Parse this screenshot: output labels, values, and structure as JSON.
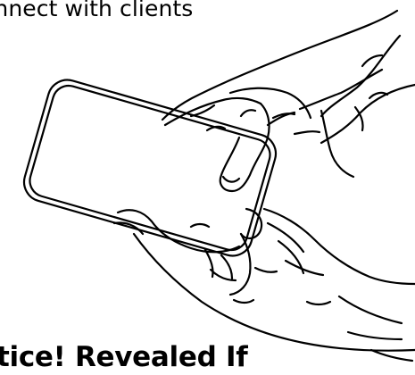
{
  "header": {
    "caption": "onnect with clients"
  },
  "footer": {
    "heading": "tice! Revealed If"
  },
  "illustration": {
    "subject": "hands-holding-phone-line-art",
    "stroke_color": "#000000",
    "background_color": "#ffffff"
  }
}
